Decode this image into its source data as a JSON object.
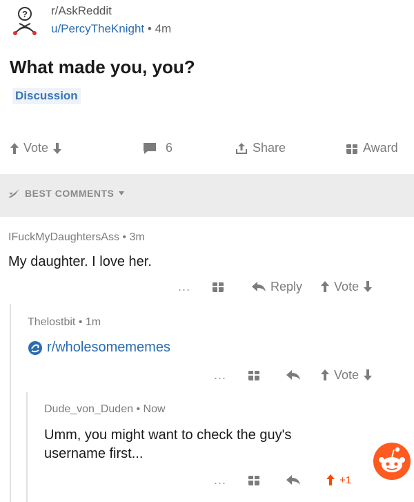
{
  "post": {
    "subreddit": "r/AskReddit",
    "author": "u/PercyTheKnight",
    "separator": "•",
    "age": "4m",
    "title": "What made you, you?",
    "flair": "Discussion"
  },
  "actions": {
    "vote_label": "Vote",
    "comment_count": "6",
    "share_label": "Share",
    "award_label": "Award"
  },
  "comments_header": {
    "label": "BEST COMMENTS"
  },
  "comments": [
    {
      "author": "IFuckMyDaughtersAss",
      "age": "3m",
      "body": "My daughter. I love her.",
      "more": "...",
      "reply_label": "Reply",
      "vote_label": "Vote"
    },
    {
      "author": "Thelostbit",
      "age": "1m",
      "body": "r/wholesomememes",
      "more": "...",
      "vote_label": "Vote"
    },
    {
      "author": "Dude_von_Duden",
      "age": "Now",
      "body": "Umm, you might want to check the guy's username first...",
      "more": "...",
      "vote_score": "+1"
    }
  ],
  "colors": {
    "link_blue": "#2b6cb0",
    "upvote_orange": "#ff4500",
    "muted_gray": "#7c7c7c"
  }
}
